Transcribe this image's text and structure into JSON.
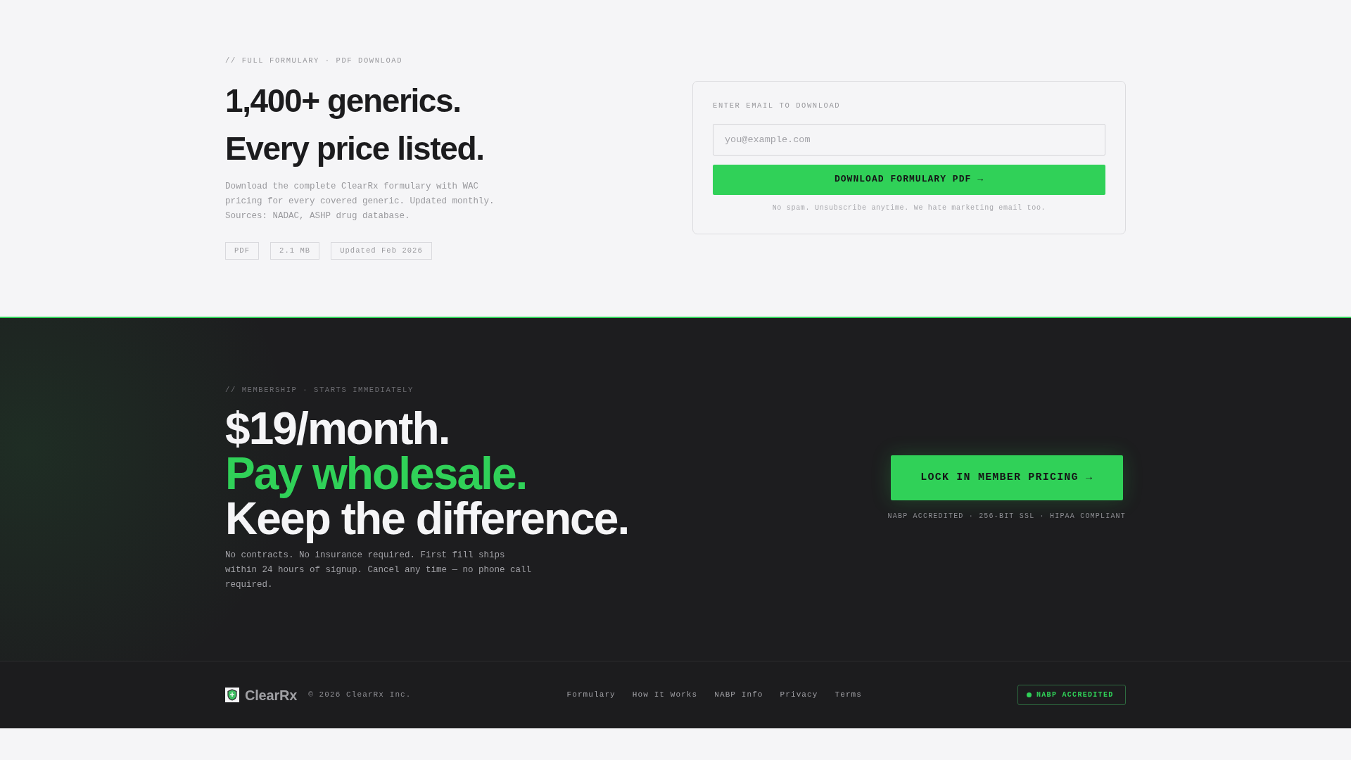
{
  "download": {
    "eyebrow": "// FULL FORMULARY · PDF DOWNLOAD",
    "headline": [
      "1,400+ generics.",
      "Every price listed."
    ],
    "description": "Download the complete ClearRx formulary with WAC pricing for every covered generic. Updated monthly. Sources: NADAC, ASHP drug database.",
    "tags": [
      "PDF",
      "2.1 MB",
      "Updated Feb 2026"
    ],
    "form": {
      "label": "ENTER EMAIL TO DOWNLOAD",
      "email": {
        "placeholder": "you@example.com"
      },
      "button": "DOWNLOAD FORMULARY PDF →",
      "note": "No spam. Unsubscribe anytime. We hate marketing email too."
    }
  },
  "membership": {
    "eyebrow": "// MEMBERSHIP · STARTS IMMEDIATELY",
    "headline": [
      {
        "text": "$19/month.",
        "color": "#f5f5f7"
      },
      {
        "text": "Pay wholesale.",
        "color": "#30d158"
      },
      {
        "text": "Keep the difference.",
        "color": "#f5f5f7"
      }
    ],
    "description": "No contracts. No insurance required. First fill ships within 24 hours of signup. Cancel any time — no phone call required.",
    "button": "LOCK IN MEMBER PRICING →",
    "trust_line": "NABP ACCREDITED · 256-BIT SSL · HIPAA COMPLIANT"
  },
  "footer": {
    "brand": "ClearRx",
    "copyright": "© 2026 ClearRx Inc.",
    "links": [
      "Formulary",
      "How It Works",
      "NABP Info",
      "Privacy",
      "Terms"
    ],
    "badge": "NABP ACCREDITED"
  }
}
